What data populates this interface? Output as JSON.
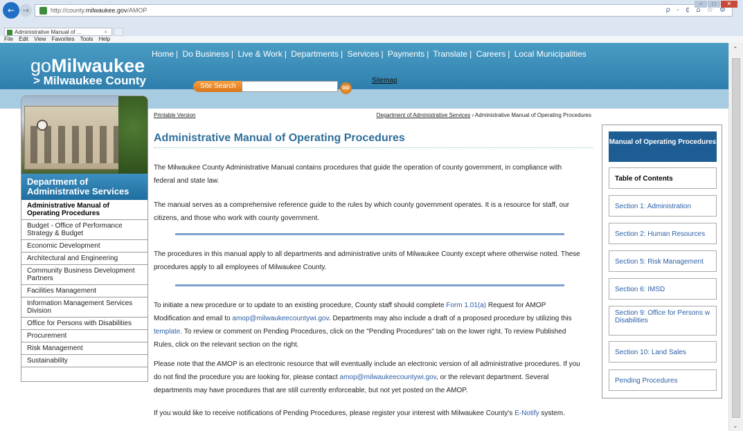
{
  "browser": {
    "url_prefix": "http://county.",
    "url_host": "milwaukee.gov",
    "url_path": "/AMOP",
    "tab_title": "Administrative Manual of ...",
    "tab_close": "×",
    "menu": [
      "File",
      "Edit",
      "View",
      "Favorites",
      "Tools",
      "Help"
    ],
    "address_tools": "ρ - ¢  ⌂ ☆ ⚙"
  },
  "header": {
    "logo_prefix": "go",
    "logo_main": "Milwaukee",
    "logo_sub": "> Milwaukee County",
    "nav": [
      "Home",
      "Do Business",
      "Live & Work",
      "Departments",
      "Services",
      "Payments",
      "Translate",
      "Careers",
      "Local Municipalities"
    ],
    "search_label": "Site Search",
    "search_value": "",
    "go_label": "GO",
    "sitemap": "Sitemap"
  },
  "sidebar": {
    "dept_title_line1": "Department of",
    "dept_title_line2": "Administrative Services",
    "items": [
      {
        "label": "Administrative Manual of Operating Procedures",
        "active": true
      },
      {
        "label": "Budget - Office of Performance Strategy & Budget"
      },
      {
        "label": "Economic Development"
      },
      {
        "label": "Architectural and Engineering"
      },
      {
        "label": "Community Business Development Partners"
      },
      {
        "label": "Facilities Management"
      },
      {
        "label": "Information Management Services Division"
      },
      {
        "label": "Office for Persons with Disabilities"
      },
      {
        "label": "Procurement"
      },
      {
        "label": "Risk Management"
      },
      {
        "label": "Sustainability"
      }
    ]
  },
  "main": {
    "printable": "Printable Version",
    "breadcrumb_link": "Department of Administrative Services",
    "breadcrumb_sep": "›",
    "breadcrumb_current": "Administrative Manual of Operating Procedures",
    "title": "Administrative Manual of Operating Procedures",
    "p1": "The Milwaukee County Administrative Manual contains procedures that guide the operation of county government, in compliance with federal and state law.",
    "p2": "The manual serves as a comprehensive reference guide to the rules by which county government operates. It is a resource for staff, our citizens, and those who work with county government.",
    "p3": "The procedures in this manual apply to all departments and administrative units of Milwaukee County except where otherwise noted. These procedures apply to all employees of Milwaukee County.",
    "p4_a": "To initiate a new procedure or to update to an existing procedure, County staff should complete ",
    "p4_form": "Form 1.01(a)",
    "p4_b": " Request for AMOP Modification and email to ",
    "p4_email": "amop@milwaukeecountywi.gov",
    "p4_c": ".  Departments may also include a draft of a proposed procedure by utilizing this ",
    "p4_template": "template",
    "p4_d": ". To review or comment on Pending Procedures, click on the \"Pending Procedures\" tab on the lower right.  To review Published Rules, click on the relevant section on the right.",
    "p5_a": "Please note that the AMOP is an electronic resource that will eventually include an electronic version of all administrative procedures. If you do not find the procedure you are looking for, please contact ",
    "p5_email": "amop@milwaukeecountywi.gov",
    "p5_b": ", or the relevant department. Several departments may have procedures that are still currently enforceable, but not yet posted on the AMOP.",
    "p6_a": "If you would like to receive notifications of Pending Procedures, please register your interest with Milwaukee County's ",
    "p6_link": "E-Notify",
    "p6_b": " system."
  },
  "right_panel": {
    "header": "Manual of Operating Procedures",
    "toc": "Table of Contents",
    "sections": [
      "Section 1: Administration",
      "Section 2: Human Resources",
      "Section 5: Risk Management",
      "Section 6: IMSD",
      "Section 9: Office for Persons w Disabilities",
      "Section 10: Land Sales",
      "Pending Procedures"
    ]
  },
  "colors": {
    "header_blue": "#2f7fae",
    "title_blue": "#2f6f9a",
    "link_blue": "#2b5fa5",
    "panel_navy": "#1d5d94",
    "search_orange": "#e88a2a"
  }
}
